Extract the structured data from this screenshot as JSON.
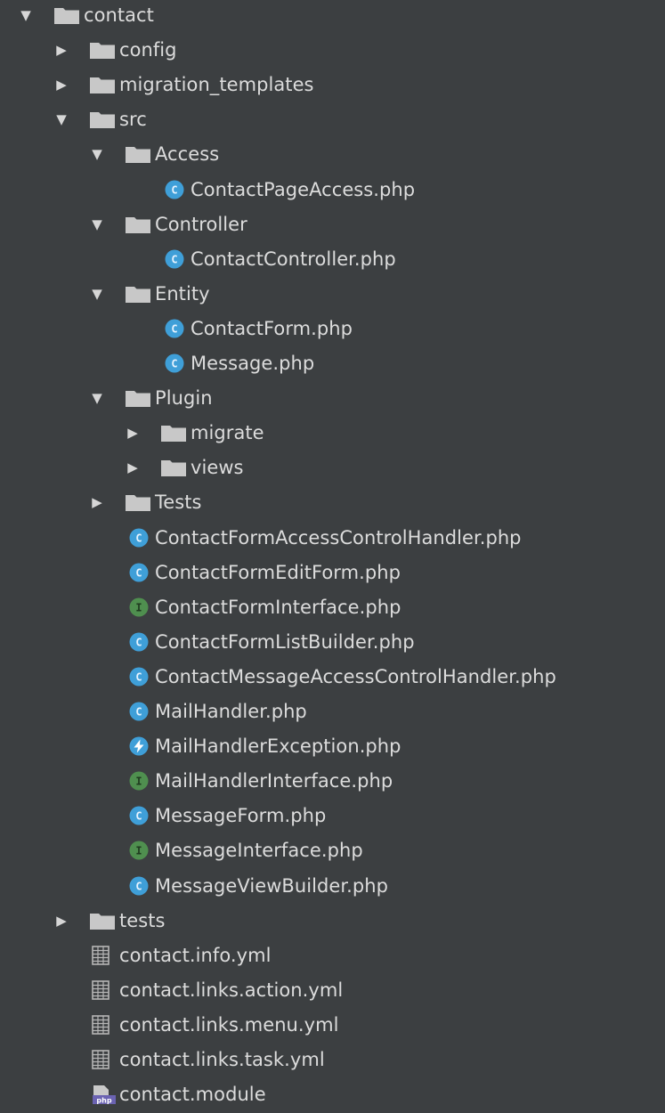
{
  "colors": {
    "background": "#3c3f41",
    "text": "#dcdcdc",
    "folder": "#c8c8c8",
    "class_icon": "#3f9fd8",
    "interface_icon": "#4f8f4f",
    "exception_icon": "#3f9fd8",
    "yml_icon": "#b6b6b6",
    "php_icon": "#6b63b2"
  },
  "tree": [
    {
      "depth": 0,
      "type": "folder",
      "expanded": true,
      "label": "contact",
      "icon": "folder-icon"
    },
    {
      "depth": 1,
      "type": "folder",
      "expanded": false,
      "label": "config",
      "icon": "folder-icon"
    },
    {
      "depth": 1,
      "type": "folder",
      "expanded": false,
      "label": "migration_templates",
      "icon": "folder-icon"
    },
    {
      "depth": 1,
      "type": "folder",
      "expanded": true,
      "label": "src",
      "icon": "folder-icon"
    },
    {
      "depth": 2,
      "type": "folder",
      "expanded": true,
      "label": "Access",
      "icon": "folder-icon"
    },
    {
      "depth": 3,
      "type": "class",
      "label": "ContactPageAccess.php",
      "icon": "php-class-icon",
      "badge": "C"
    },
    {
      "depth": 2,
      "type": "folder",
      "expanded": true,
      "label": "Controller",
      "icon": "folder-icon"
    },
    {
      "depth": 3,
      "type": "class",
      "label": "ContactController.php",
      "icon": "php-class-icon",
      "badge": "C"
    },
    {
      "depth": 2,
      "type": "folder",
      "expanded": true,
      "label": "Entity",
      "icon": "folder-icon"
    },
    {
      "depth": 3,
      "type": "class",
      "label": "ContactForm.php",
      "icon": "php-class-icon",
      "badge": "C"
    },
    {
      "depth": 3,
      "type": "class",
      "label": "Message.php",
      "icon": "php-class-icon",
      "badge": "C"
    },
    {
      "depth": 2,
      "type": "folder",
      "expanded": true,
      "label": "Plugin",
      "icon": "folder-icon"
    },
    {
      "depth": 3,
      "type": "folder",
      "expanded": false,
      "label": "migrate",
      "icon": "folder-icon"
    },
    {
      "depth": 3,
      "type": "folder",
      "expanded": false,
      "label": "views",
      "icon": "folder-icon"
    },
    {
      "depth": 2,
      "type": "folder",
      "expanded": false,
      "label": "Tests",
      "icon": "folder-icon"
    },
    {
      "depth": 2,
      "type": "class",
      "label": "ContactFormAccessControlHandler.php",
      "icon": "php-class-icon",
      "badge": "C"
    },
    {
      "depth": 2,
      "type": "class",
      "label": "ContactFormEditForm.php",
      "icon": "php-class-icon",
      "badge": "C"
    },
    {
      "depth": 2,
      "type": "interface",
      "label": "ContactFormInterface.php",
      "icon": "php-interface-icon",
      "badge": "I"
    },
    {
      "depth": 2,
      "type": "class",
      "label": "ContactFormListBuilder.php",
      "icon": "php-class-icon",
      "badge": "C"
    },
    {
      "depth": 2,
      "type": "class",
      "label": "ContactMessageAccessControlHandler.php",
      "icon": "php-class-icon",
      "badge": "C"
    },
    {
      "depth": 2,
      "type": "class",
      "label": "MailHandler.php",
      "icon": "php-class-icon",
      "badge": "C"
    },
    {
      "depth": 2,
      "type": "exception",
      "label": "MailHandlerException.php",
      "icon": "php-exception-icon",
      "badge": "⚡"
    },
    {
      "depth": 2,
      "type": "interface",
      "label": "MailHandlerInterface.php",
      "icon": "php-interface-icon",
      "badge": "I"
    },
    {
      "depth": 2,
      "type": "class",
      "label": "MessageForm.php",
      "icon": "php-class-icon",
      "badge": "C"
    },
    {
      "depth": 2,
      "type": "interface",
      "label": "MessageInterface.php",
      "icon": "php-interface-icon",
      "badge": "I"
    },
    {
      "depth": 2,
      "type": "class",
      "label": "MessageViewBuilder.php",
      "icon": "php-class-icon",
      "badge": "C"
    },
    {
      "depth": 1,
      "type": "folder",
      "expanded": false,
      "label": "tests",
      "icon": "folder-icon"
    },
    {
      "depth": 1,
      "type": "yml",
      "label": "contact.info.yml",
      "icon": "yml-file-icon"
    },
    {
      "depth": 1,
      "type": "yml",
      "label": "contact.links.action.yml",
      "icon": "yml-file-icon"
    },
    {
      "depth": 1,
      "type": "yml",
      "label": "contact.links.menu.yml",
      "icon": "yml-file-icon"
    },
    {
      "depth": 1,
      "type": "yml",
      "label": "contact.links.task.yml",
      "icon": "yml-file-icon"
    },
    {
      "depth": 1,
      "type": "module",
      "label": "contact.module",
      "icon": "php-module-icon"
    }
  ]
}
